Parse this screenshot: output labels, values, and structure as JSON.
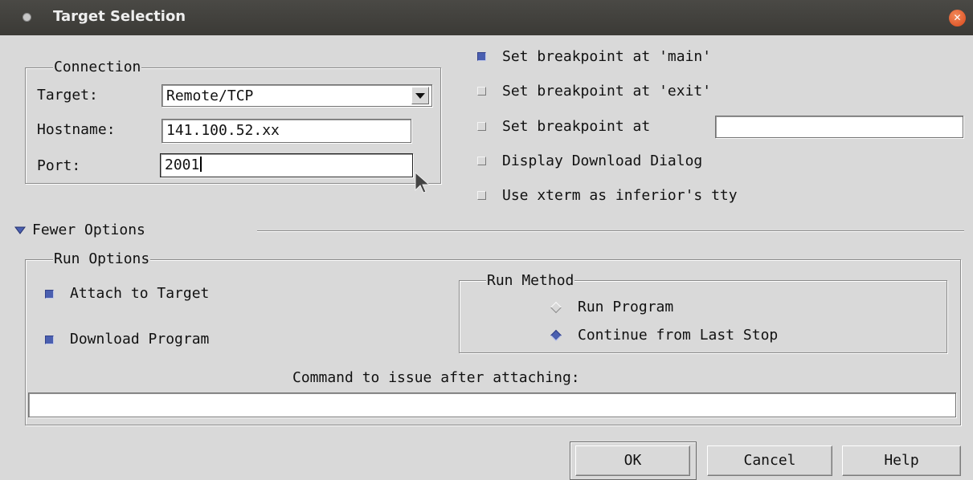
{
  "window": {
    "title": "Target Selection",
    "close_icon": "close-icon"
  },
  "connection": {
    "legend": "Connection",
    "target_label": "Target:",
    "target_value": "Remote/TCP",
    "hostname_label": "Hostname:",
    "hostname_value": "141.100.52.xx",
    "port_label": "Port:",
    "port_value": "2001"
  },
  "options": {
    "bp_main": {
      "label": "Set breakpoint at 'main'",
      "checked": true
    },
    "bp_exit": {
      "label": "Set breakpoint at 'exit'",
      "checked": false
    },
    "bp_at": {
      "label": "Set breakpoint at",
      "checked": false,
      "value": ""
    },
    "download_dialog": {
      "label": "Display Download Dialog",
      "checked": false
    },
    "xterm": {
      "label": "Use xterm as inferior's tty",
      "checked": false
    }
  },
  "toggle": {
    "label": "Fewer Options",
    "icon": "triangle-down-icon"
  },
  "run_options": {
    "legend": "Run Options",
    "attach": {
      "label": "Attach to Target",
      "checked": true
    },
    "download": {
      "label": "Download Program",
      "checked": true
    },
    "run_method": {
      "legend": "Run Method",
      "run_program": {
        "label": "Run Program",
        "selected": false
      },
      "continue": {
        "label": "Continue from Last Stop",
        "selected": true
      }
    },
    "command_label": "Command to issue after attaching:",
    "command_value": ""
  },
  "buttons": {
    "ok": "OK",
    "cancel": "Cancel",
    "help": "Help"
  },
  "colors": {
    "accent": "#4a5fb0",
    "close": "#e05a28"
  }
}
